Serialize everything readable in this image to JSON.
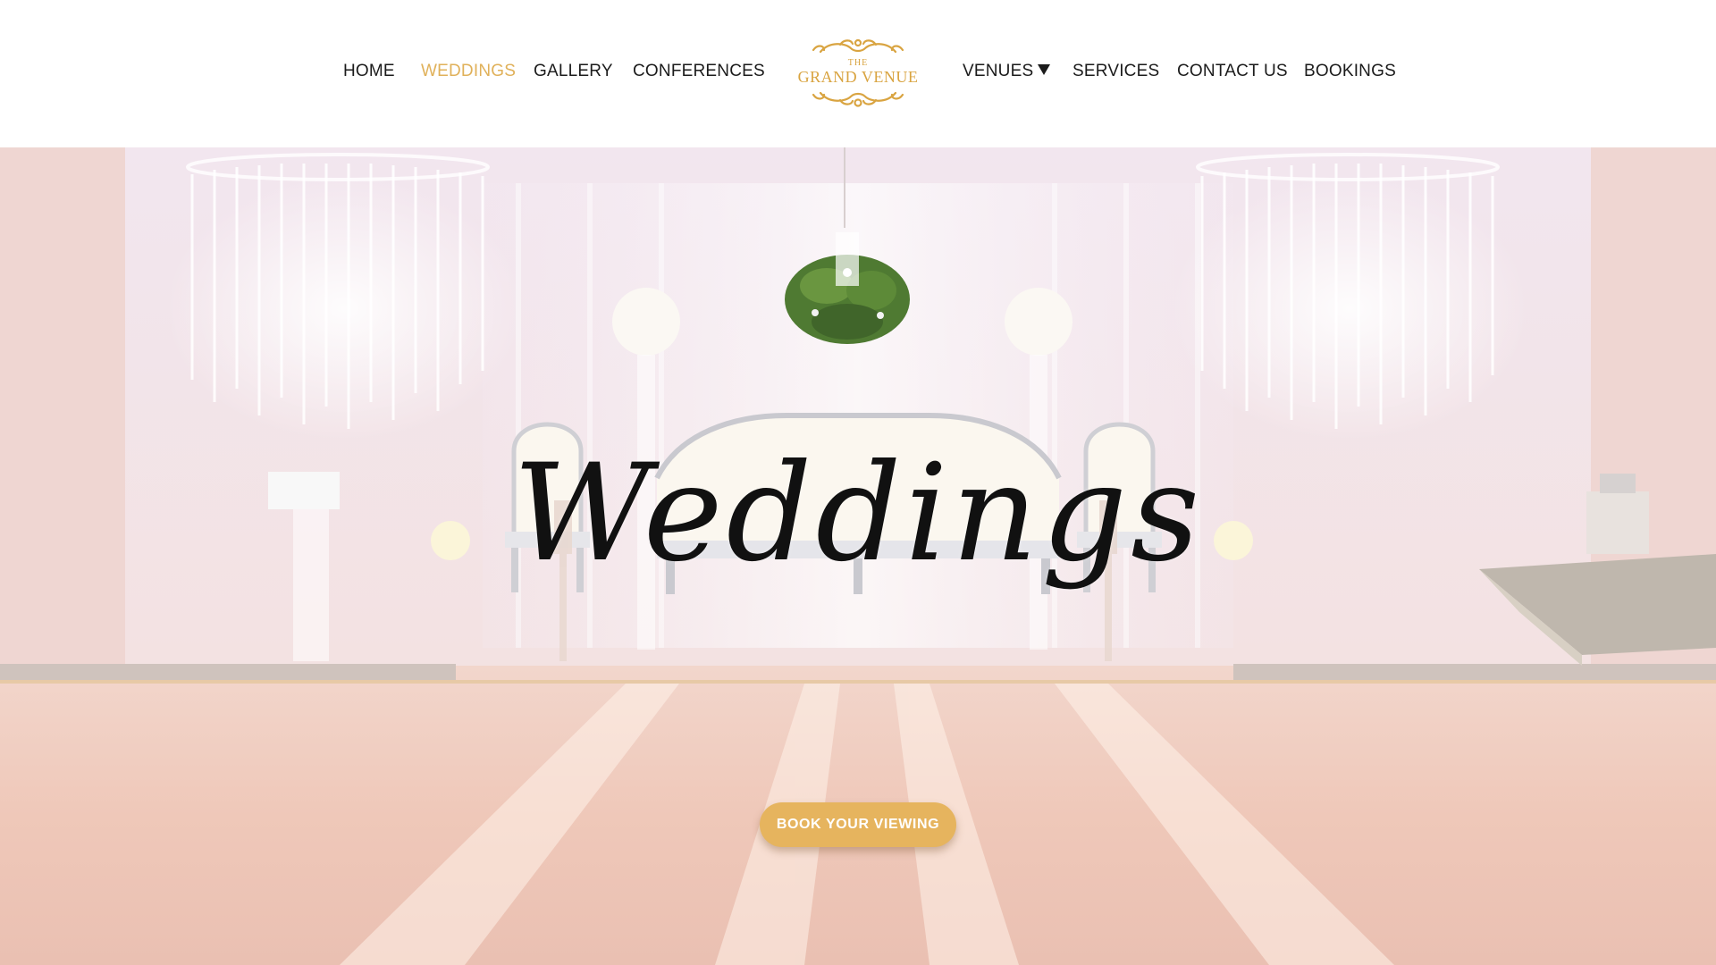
{
  "nav": {
    "left": [
      {
        "label": "HOME"
      },
      {
        "label": "WEDDINGS",
        "active": true
      },
      {
        "label": "GALLERY"
      },
      {
        "label": "CONFERENCES"
      }
    ],
    "right": [
      {
        "label": "VENUES",
        "has_dropdown": true
      },
      {
        "label": "SERVICES"
      },
      {
        "label": "CONTACT US"
      },
      {
        "label": "BOOKINGS"
      }
    ]
  },
  "logo": {
    "line1": "THE",
    "line2": "GRAND VENUE"
  },
  "hero": {
    "title": "Weddings",
    "cta_label": "BOOK YOUR VIEWING"
  },
  "colors": {
    "accent_gold": "#e6b45e",
    "nav_active": "#e0b15a",
    "nav_text": "#1b1b1b",
    "cta_text": "#ffffff"
  },
  "icons": {
    "venues_dropdown": "caret-down-icon",
    "logo_ornament": "ornament-scroll-icon"
  }
}
